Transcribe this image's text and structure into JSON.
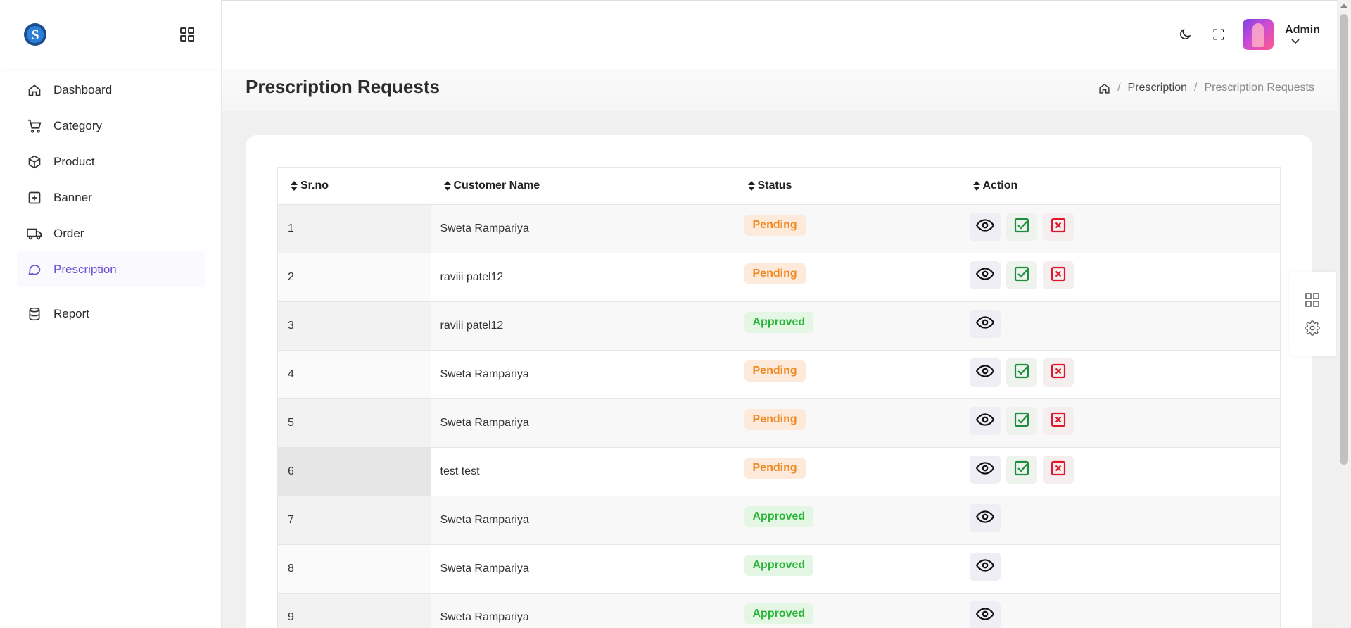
{
  "app": {
    "nav": [
      {
        "label": "Dashboard",
        "icon": "home-icon"
      },
      {
        "label": "Category",
        "icon": "cart-icon"
      },
      {
        "label": "Product",
        "icon": "box-icon"
      },
      {
        "label": "Banner",
        "icon": "plus-square-icon"
      },
      {
        "label": "Order",
        "icon": "truck-icon"
      },
      {
        "label": "Prescription",
        "icon": "chat-icon",
        "active": true
      },
      {
        "label": "Report",
        "icon": "database-icon"
      }
    ]
  },
  "header": {
    "user_name": "Admin"
  },
  "page": {
    "title": "Prescription Requests",
    "breadcrumb": [
      "Prescription",
      "Prescription Requests"
    ]
  },
  "table": {
    "columns": [
      "Sr.no",
      "Customer Name",
      "Status",
      "Action"
    ],
    "rows": [
      {
        "sr": "1",
        "name": "Sweta Rampariya",
        "status": "Pending"
      },
      {
        "sr": "2",
        "name": "raviii patel12",
        "status": "Pending"
      },
      {
        "sr": "3",
        "name": "raviii patel12",
        "status": "Approved"
      },
      {
        "sr": "4",
        "name": "Sweta Rampariya",
        "status": "Pending"
      },
      {
        "sr": "5",
        "name": "Sweta Rampariya",
        "status": "Pending"
      },
      {
        "sr": "6",
        "name": "test test",
        "status": "Pending"
      },
      {
        "sr": "7",
        "name": "Sweta Rampariya",
        "status": "Approved"
      },
      {
        "sr": "8",
        "name": "Sweta Rampariya",
        "status": "Approved"
      },
      {
        "sr": "9",
        "name": "Sweta Rampariya",
        "status": "Approved"
      }
    ]
  },
  "colors": {
    "accent": "#6b4fd8",
    "pending": "#f08a24",
    "approved": "#2ab53a",
    "approve_icon": "#1e8e3e",
    "reject_icon": "#e0162b"
  }
}
